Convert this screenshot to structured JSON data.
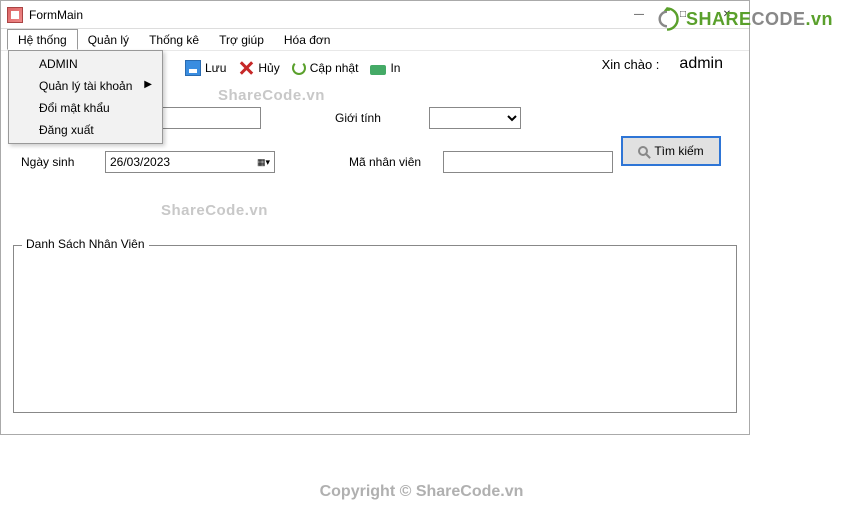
{
  "window": {
    "title": "FormMain"
  },
  "menubar": {
    "items": [
      "Hệ thống",
      "Quản lý",
      "Thống kê",
      "Trợ giúp",
      "Hóa đơn"
    ]
  },
  "dropdown": {
    "items": [
      {
        "label": "ADMIN",
        "submenu": false
      },
      {
        "label": "Quản lý tài khoản",
        "submenu": true
      },
      {
        "label": "Đổi mật khẩu",
        "submenu": false
      },
      {
        "label": "Đăng xuất",
        "submenu": false
      }
    ]
  },
  "toolbar": {
    "save": "Lưu",
    "cancel": "Hủy",
    "update": "Cập nhật",
    "print": "In"
  },
  "greeting": {
    "hello": "Xin chào :",
    "user": "admin"
  },
  "form": {
    "gender_label": "Giới tính",
    "dob_label": "Ngày sinh",
    "dob_value": "26/03/2023",
    "empid_label": "Mã nhân viên",
    "search_btn": "Tìm kiếm"
  },
  "groupbox": {
    "title": "Danh Sách Nhân Viên"
  },
  "watermarks": {
    "wm": "ShareCode.vn"
  },
  "logo": {
    "share": "SHARE",
    "code": "CODE",
    "tld": ".vn"
  },
  "footer": {
    "text": "Copyright © ShareCode.vn"
  }
}
